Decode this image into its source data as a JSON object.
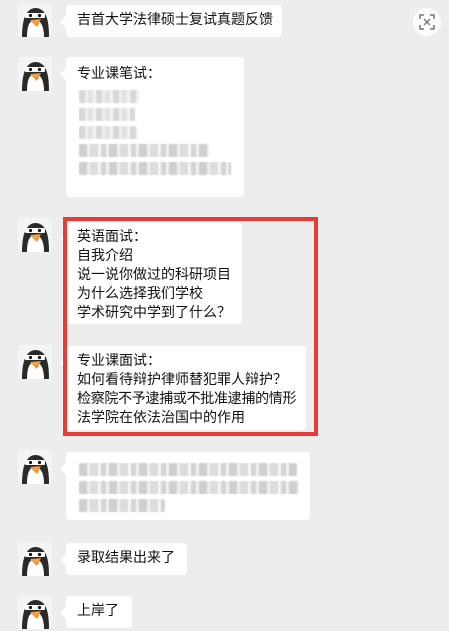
{
  "messages": [
    {
      "lines": [
        "吉首大学法律硕士复试真题反馈"
      ]
    },
    {
      "lines": [
        "专业课笔试："
      ]
    },
    {
      "lines": [
        "英语面试：",
        "自我介绍",
        "说一说你做过的科研项目",
        "为什么选择我们学校",
        "学术研究中学到了什么？"
      ]
    },
    {
      "lines": [
        "专业课面试：",
        "如何看待辩护律师替犯罪人辩护？",
        "检察院不予逮捕或不批准逮捕的情形",
        "法学院在依法治国中的作用"
      ]
    },
    {
      "lines": []
    },
    {
      "lines": [
        "录取结果出来了"
      ]
    },
    {
      "lines": [
        "上岸了"
      ]
    }
  ],
  "colors": {
    "highlight": "#e93a3a",
    "background": "#ededed",
    "bubble": "#ffffff"
  },
  "icons": {
    "avatar": "penguin-avatar-icon",
    "top_right": "scan-icon"
  }
}
